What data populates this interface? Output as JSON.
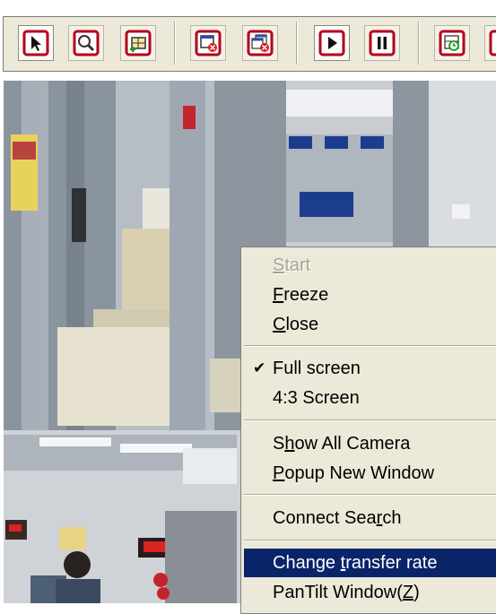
{
  "toolbar": {
    "buttons": [
      {
        "name": "select-pointer-button",
        "icon": "arrow-pointer-icon",
        "pressed": true
      },
      {
        "name": "zoom-button",
        "icon": "magnifier-icon",
        "pressed": false
      },
      {
        "name": "add-camera-button",
        "icon": "camera-add-icon",
        "pressed": false
      },
      {
        "name": "close-window-button",
        "icon": "window-close-icon",
        "pressed": false
      },
      {
        "name": "close-all-windows-button",
        "icon": "multi-window-close-icon",
        "pressed": false
      },
      {
        "name": "play-button",
        "icon": "play-icon",
        "pressed": true
      },
      {
        "name": "pause-button",
        "icon": "pause-icon",
        "pressed": false
      },
      {
        "name": "record-schedule-button",
        "icon": "clock-window-icon",
        "pressed": false
      }
    ],
    "accent_color": "#b3001b"
  },
  "context_menu": {
    "items": [
      {
        "pre": "",
        "u": "S",
        "post": "tart",
        "state": "disabled"
      },
      {
        "pre": "",
        "u": "F",
        "post": "reeze",
        "state": ""
      },
      {
        "pre": "",
        "u": "C",
        "post": "lose",
        "state": ""
      },
      {
        "pre": "Full screen",
        "u": "",
        "post": "",
        "state": "checked"
      },
      {
        "pre": "4:3 Screen",
        "u": "",
        "post": "",
        "state": ""
      },
      {
        "pre": "S",
        "u": "h",
        "post": "ow All Camera",
        "state": ""
      },
      {
        "pre": "",
        "u": "P",
        "post": "opup New Window",
        "state": ""
      },
      {
        "pre": "Connect Sea",
        "u": "r",
        "post": "ch",
        "state": ""
      },
      {
        "pre": "Change ",
        "u": "t",
        "post": "ransfer rate",
        "state": "highlighted"
      },
      {
        "pre": "PanTilt Window(",
        "u": "Z",
        "post": ")",
        "state": ""
      }
    ],
    "check_glyph": "✔",
    "highlight_color": "#0a246a"
  }
}
